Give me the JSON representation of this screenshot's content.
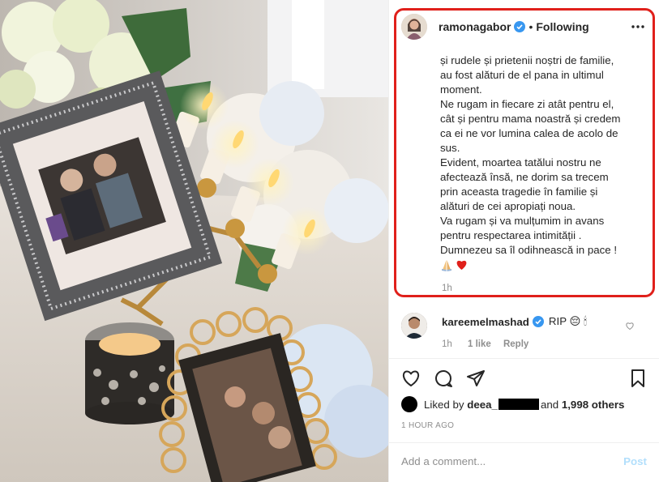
{
  "post": {
    "author": "ramonagabor",
    "separator": "•",
    "follow_status": "Following",
    "more_icon": "more-horizontal-icon",
    "caption_lines": [
      "și rudele și prietenii noștri de familie,",
      "au fost alături de el pana in ultimul",
      "moment.",
      "Ne rugam in fiecare zi atât pentru el,",
      "cât și pentru mama noastră și credem",
      "ca ei ne vor lumina calea de acolo de",
      "sus.",
      "Evident, moartea tatălui nostru ne",
      "afectează însă, ne dorim sa trecem",
      "prin aceasta tragedie în familie și",
      "alături de cei apropiați noua.",
      "Va rugam și va mulțumim in avans",
      "pentru respectarea intimității .",
      "Dumnezeu sa îl odihnească in pace !"
    ],
    "caption_time": "1h"
  },
  "comment": {
    "user": "kareemelmashad",
    "text": "RIP 😔 🕯",
    "time": "1h",
    "likes": "1 like",
    "reply": "Reply"
  },
  "likes": {
    "prefix": "Liked by",
    "first_user": "deea_",
    "connector": "and",
    "others": "1,998 others"
  },
  "timestamp": "1 HOUR AGO",
  "add_comment": {
    "placeholder": "Add a comment...",
    "post_label": "Post"
  },
  "colors": {
    "highlight": "#e0201b",
    "verified": "#3897f0",
    "heart": "#e0201b",
    "post_disabled": "#b2dffc"
  }
}
